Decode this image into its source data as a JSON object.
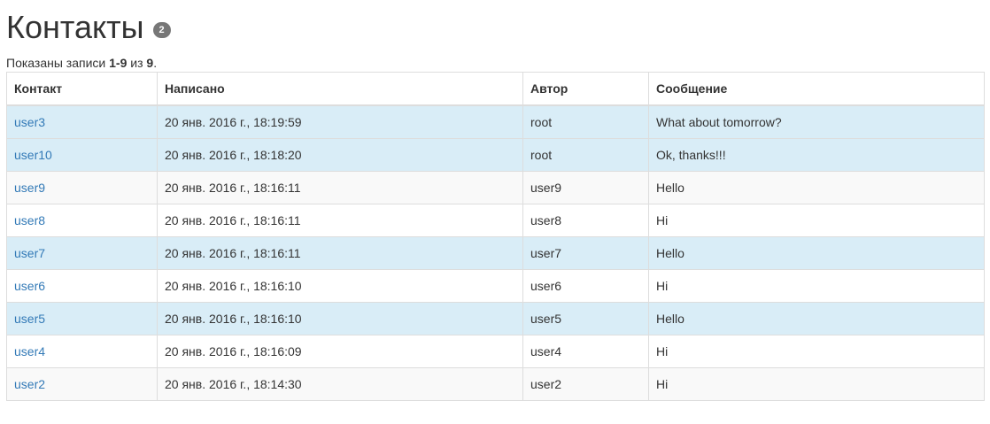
{
  "page": {
    "title": "Контакты",
    "badge_count": "2"
  },
  "summary": {
    "prefix": "Показаны записи ",
    "range": "1-9",
    "middle": " из ",
    "total": "9",
    "suffix": "."
  },
  "table": {
    "headers": {
      "contact": "Контакт",
      "written": "Написано",
      "author": "Автор",
      "message": "Сообщение"
    },
    "rows": [
      {
        "contact": "user3",
        "written": "20 янв. 2016 г., 18:19:59",
        "author": "root",
        "message": "What about tomorrow?",
        "highlight": "info"
      },
      {
        "contact": "user10",
        "written": "20 янв. 2016 г., 18:18:20",
        "author": "root",
        "message": "Ok, thanks!!!",
        "highlight": "info"
      },
      {
        "contact": "user9",
        "written": "20 янв. 2016 г., 18:16:11",
        "author": "user9",
        "message": "Hello",
        "highlight": "stripe"
      },
      {
        "contact": "user8",
        "written": "20 янв. 2016 г., 18:16:11",
        "author": "user8",
        "message": "Hi",
        "highlight": "white"
      },
      {
        "contact": "user7",
        "written": "20 янв. 2016 г., 18:16:11",
        "author": "user7",
        "message": "Hello",
        "highlight": "info"
      },
      {
        "contact": "user6",
        "written": "20 янв. 2016 г., 18:16:10",
        "author": "user6",
        "message": "Hi",
        "highlight": "white"
      },
      {
        "contact": "user5",
        "written": "20 янв. 2016 г., 18:16:10",
        "author": "user5",
        "message": "Hello",
        "highlight": "info"
      },
      {
        "contact": "user4",
        "written": "20 янв. 2016 г., 18:16:09",
        "author": "user4",
        "message": "Hi",
        "highlight": "white"
      },
      {
        "contact": "user2",
        "written": "20 янв. 2016 г., 18:14:30",
        "author": "user2",
        "message": "Hi",
        "highlight": "stripe"
      }
    ]
  },
  "colors": {
    "link": "#337ab7",
    "info_row": "#d9edf7",
    "stripe_row": "#f9f9f9",
    "badge": "#777777",
    "border": "#dddddd"
  }
}
